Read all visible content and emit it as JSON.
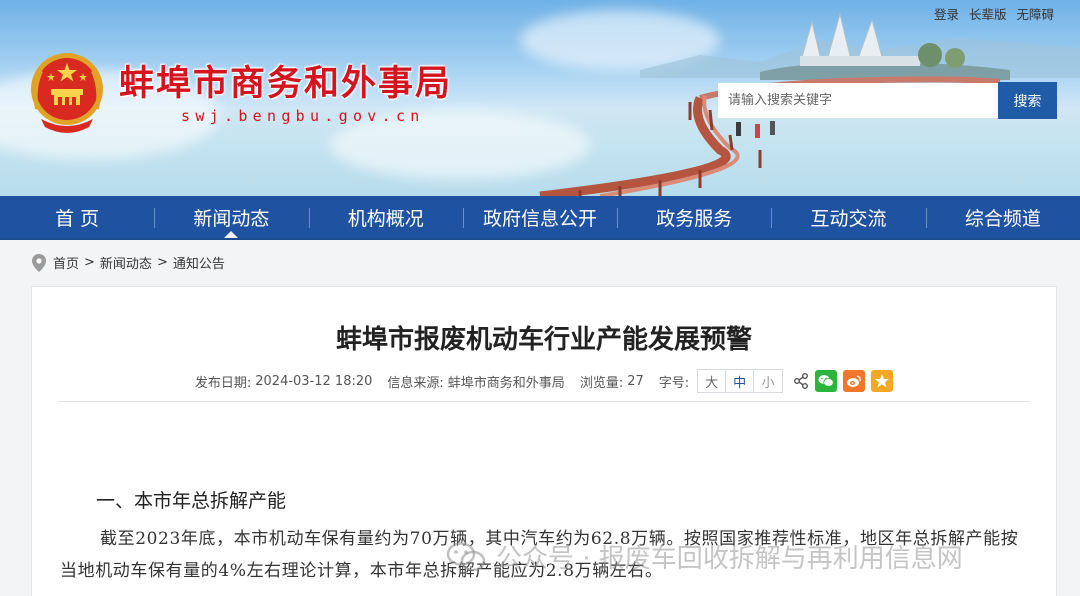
{
  "header": {
    "site_title": "蚌埠市商务和外事局",
    "site_domain": "swj.bengbu.gov.cn",
    "top_links": [
      "登录",
      "长辈版",
      "无障碍"
    ],
    "search": {
      "placeholder": "请输入搜索关键字",
      "button_label": "搜索"
    }
  },
  "nav": {
    "items": [
      {
        "label": "首 页",
        "active": false
      },
      {
        "label": "新闻动态",
        "active": true
      },
      {
        "label": "机构概况",
        "active": false
      },
      {
        "label": "政府信息公开",
        "active": false
      },
      {
        "label": "政务服务",
        "active": false
      },
      {
        "label": "互动交流",
        "active": false
      },
      {
        "label": "综合频道",
        "active": false
      }
    ]
  },
  "breadcrumb": [
    "首页",
    "新闻动态",
    "通知公告"
  ],
  "breadcrumb_separator": ">",
  "article": {
    "title": "蚌埠市报废机动车行业产能发展预警",
    "meta": {
      "date_label": "发布日期:",
      "date": "2024-03-12 18:20",
      "source_label": "信息来源:",
      "source": "蚌埠市商务和外事局",
      "views_label": "浏览量:",
      "views": "27",
      "font_size_label": "字号:",
      "font_sizes": [
        "大",
        "中",
        "小"
      ]
    },
    "section_heading": "一、本市年总拆解产能",
    "paragraph": "截至2023年底，本市机动车保有量约为70万辆，其中汽车约为62.8万辆。按照国家推荐性标准，地区年总拆解产能按当地机动车保有量的4%左右理论计算，本市年总拆解产能应为2.8万辆左右。"
  },
  "watermark": "公众号 · 报废车回收拆解与再利用信息网",
  "colors": {
    "nav_bg": "#1f53a2",
    "title_red": "#d4141e",
    "search_button": "#1f5ba6",
    "wechat_green": "#2bb53c",
    "weibo_orange": "#f2762b",
    "favorite_orange": "#f5a623"
  },
  "icons": [
    "location-pin-icon",
    "share-icon",
    "wechat-icon",
    "weibo-icon",
    "favorite-star-icon",
    "national-emblem-icon"
  ]
}
